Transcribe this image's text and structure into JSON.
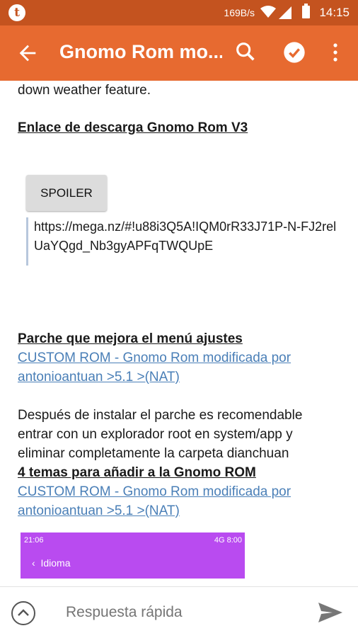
{
  "status_bar": {
    "app_icon": "t",
    "net_rate": "169B/s",
    "time": "14:15",
    "icons": [
      "wifi-icon",
      "signal-icon",
      "battery-icon"
    ]
  },
  "toolbar": {
    "title": "Gnomo Rom mo...",
    "icons": [
      "back-arrow-icon",
      "search-icon",
      "check-circle-icon",
      "more-vert-icon"
    ]
  },
  "post": {
    "intro_tail": "down weather feature.",
    "download_heading": "Enlace de descarga Gnomo Rom V3",
    "spoiler_label": "SPOILER",
    "spoiler_link": "https://mega.nz/#!u88i3Q5A!IQM0rR33J71P-N-FJ2relUaYQgd_Nb3gyAPFqTWQUpE",
    "patch_heading": "Parche que mejora el menú ajustes",
    "patch_link": "CUSTOM ROM - Gnomo Rom modificada por antonioantuan >5.1 >(NAT)",
    "patch_note": "Después de instalar el parche es recomendable entrar con un explorador root en system/app y eliminar completamente la carpeta dianchuan",
    "themes_heading": "4 temas para añadir a la Gnomo ROM",
    "themes_link": "CUSTOM ROM - Gnomo Rom modificada por antonioantuan >5.1 >(NAT)"
  },
  "screenshot_preview": {
    "time": "21:06",
    "status_right": "4G 8:00",
    "nav_label": "Idioma",
    "bg_color": "#b94bf0"
  },
  "reply_bar": {
    "placeholder": "Respuesta rápida"
  },
  "colors": {
    "toolbar": "#e76a30",
    "status_bar": "#c4531f",
    "link": "#4a7fb7"
  }
}
